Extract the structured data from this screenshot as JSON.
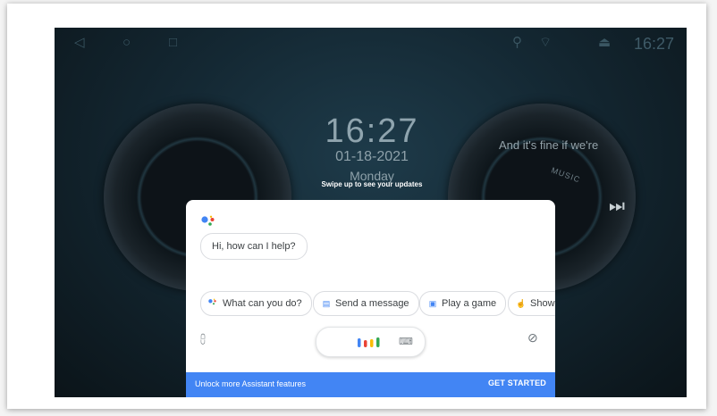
{
  "statusbar": {
    "icons": [
      "back-triangle-icon",
      "home-circle-icon",
      "recents-square-icon",
      "location-icon",
      "wifi-icon",
      "eject-icon"
    ],
    "time": "16:27"
  },
  "clock": {
    "time": "16:27",
    "date": "01-18-2021",
    "day": "Monday",
    "swipe_hint": "Swipe up to see your updates"
  },
  "music": {
    "song_text": "And it's fine if we're",
    "label": "MUSIC"
  },
  "assistant": {
    "greeting": "Hi, how can I help?",
    "chips": [
      {
        "label": "What can you do?",
        "icon": "assistant-icon"
      },
      {
        "label": "Send a message",
        "icon": "message-icon"
      },
      {
        "label": "Play a game",
        "icon": "gamepad-icon"
      },
      {
        "label": "Show",
        "icon": "hand-icon"
      }
    ],
    "banner_text": "Unlock more Assistant features",
    "banner_button": "GET STARTED"
  },
  "colors": {
    "accent": "#4285f4",
    "google_blue": "#4285f4",
    "google_red": "#ea4335",
    "google_yellow": "#fbbc05",
    "google_green": "#34a853"
  }
}
